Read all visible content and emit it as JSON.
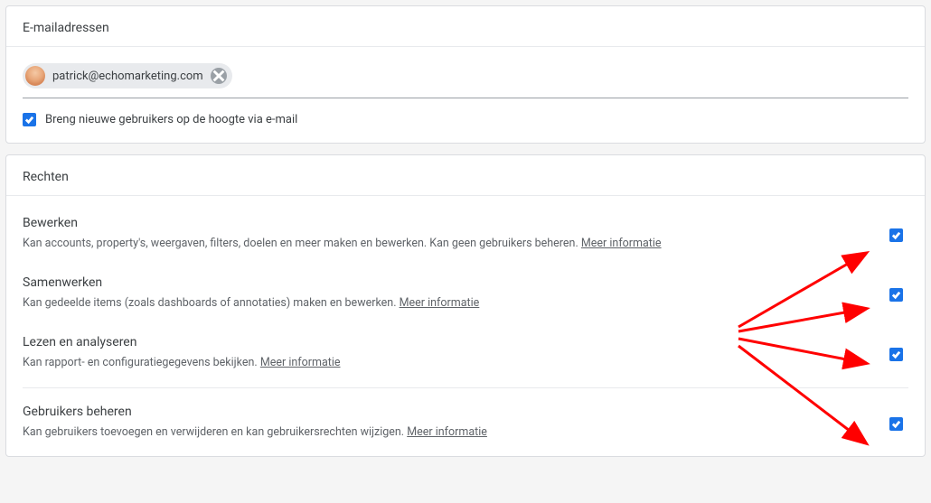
{
  "emails_card": {
    "header": "E-mailadressen",
    "chip_email": "patrick@echomarketing.com",
    "notify_checkbox_label": "Breng nieuwe gebruikers op de hoogte via e-mail",
    "notify_checked": true
  },
  "permissions_card": {
    "header": "Rechten",
    "more_info_label": "Meer informatie",
    "rows": [
      {
        "title": "Bewerken",
        "desc": "Kan accounts, property's, weergaven, filters, doelen en meer maken en bewerken. Kan geen gebruikers beheren.",
        "checked": true
      },
      {
        "title": "Samenwerken",
        "desc": "Kan gedeelde items (zoals dashboards of annotaties) maken en bewerken.",
        "checked": true
      },
      {
        "title": "Lezen en analyseren",
        "desc": "Kan rapport- en configuratiegegevens bekijken.",
        "checked": true
      },
      {
        "title": "Gebruikers beheren",
        "desc": "Kan gebruikers toevoegen en verwijderen en kan gebruikersrechten wijzigen.",
        "checked": true
      }
    ]
  },
  "annotation": {
    "arrow_color": "#ff0000"
  }
}
